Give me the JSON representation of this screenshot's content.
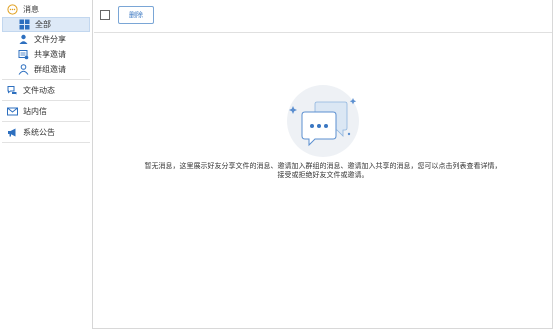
{
  "sidebar": {
    "messages_label": "消息",
    "items": [
      {
        "label": "全部",
        "icon": "grid-icon",
        "active": true
      },
      {
        "label": "文件分享",
        "icon": "person-share-icon"
      },
      {
        "label": "共享邀请",
        "icon": "shared-folder-icon"
      },
      {
        "label": "群组邀请",
        "icon": "group-invite-icon"
      }
    ],
    "file_activity_label": "文件动态",
    "inbox_label": "站内信",
    "announcement_label": "系统公告"
  },
  "toolbar": {
    "delete_label": "删除"
  },
  "empty_state": {
    "message_line1": "暂无消息，这里展示好友分享文件的消息、邀请加入群组的消息、邀请加入共享的消息，您可以点击列表查看详情，",
    "message_line2": "接受或拒绝好友文件或邀请。"
  },
  "colors": {
    "accent": "#3a77c2",
    "active_bg": "#dde9f7",
    "icon_blue": "#2d6fbf"
  }
}
